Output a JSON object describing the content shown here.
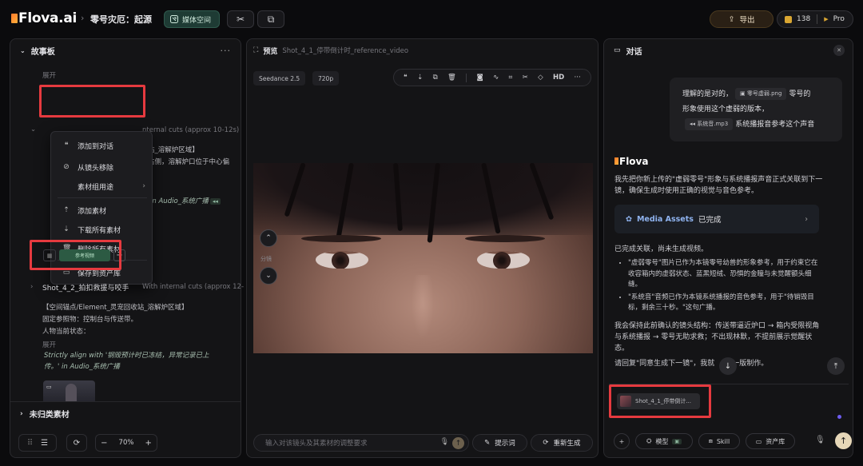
{
  "app": {
    "logo": "Flova.ai",
    "crumb_sep": "›",
    "project": "零号灾厄：起源",
    "media_space": "媒体空间",
    "export": "导出",
    "credits": "138",
    "plan": "Pro",
    "accent": "#e6d7b8",
    "highlight_color": "#e63a3f"
  },
  "storyboard": {
    "title": "故事板",
    "more": "···",
    "expand_top": "展开",
    "shot1_suffix": "nternal cuts (approx 10-12s)",
    "shot1_line1": "站_溶解炉区域】",
    "shot1_line2": "右侧，溶解炉口位于中心偏",
    "shot1_italic": "' in Audio_系统广播",
    "context_menu": {
      "add_to_chat": "添加到对话",
      "remove_from_shot": "从镜头移除",
      "asset_usage": "素材组用途",
      "add_asset": "添加素材",
      "download_all": "下载所有素材",
      "delete_all": "删除所有素材",
      "save_to_library": "保存到资产库"
    },
    "asset_tag": "参考视频",
    "shot2_title": "Shot_4_2_拍扣救援与咬手",
    "shot2_suffix": "With internal cuts (approx 12-",
    "shot2_line1": "【空间锚点/Element_灵宠回收站_溶解炉区域】",
    "shot2_line2": "固定参照物：控制台与传送带。",
    "shot2_line3": "人物当前状态：",
    "expand_bottom": "展开",
    "shot2_italic1": "Strictly align with '钢毁预计时已冻结，异常记录已上",
    "shot2_italic2": "传。' in Audio_系统广播",
    "uncategorized": "未归类素材",
    "zoom": "70%"
  },
  "preview": {
    "label": "预览",
    "filename": "Shot_4_1_停带倒计时_reference_video",
    "model": "Seedance 2.5",
    "resolution": "720p",
    "hd": "HD",
    "split_label": "分镜",
    "prompt_placeholder": "输入对该镜头及其素材的调整要求",
    "prompt_words": "提示词",
    "regenerate": "重新生成"
  },
  "chat": {
    "title": "对话",
    "user_line1_a": "理解的是对的，",
    "user_file_1": "零号虚弱.png",
    "user_line1_b": "零号的",
    "user_line2": "形象使用这个虚弱的版本，",
    "user_file_2": "系统音.mp3",
    "user_line3": "系统播报音参考这个声音",
    "assistant_name": "Flova",
    "para1": "我先把你新上传的\"虚弱零号\"形象与系统播报声音正式关联到下一镜，确保生成时使用正确的视觉与音色参考。",
    "media_assets": "Media Assets",
    "done": "已完成",
    "para2": "已完成关联，尚未生成视频。",
    "bullet1": "\"虚弱零号\"图片已作为本镜零号幼兽的形象参考，用于约束它在收容箱内的虚弱状态、蓝黑短绒、恐惧的金瞳与未觉醒额头细缝。",
    "bullet2": "\"系统音\"音频已作为本镜系统播报的音色参考，用于\"待销毁目标，剩余三十秒。\"这句广播。",
    "para3": "我会保持此前确认的镜头结构：传送带逼近炉口 → 箱内受限视角与系统播报 → 零号无助求救；不出现林默，不提前展示觉醒状态。",
    "para4": "请回复\"同意生成下一镜\"，我就",
    "para4_tail": "一版制作。",
    "ref_chip": "Shot_4_1_停带倒计...",
    "model_btn": "模型",
    "skill_btn": "Skill",
    "library_btn": "资产库"
  }
}
